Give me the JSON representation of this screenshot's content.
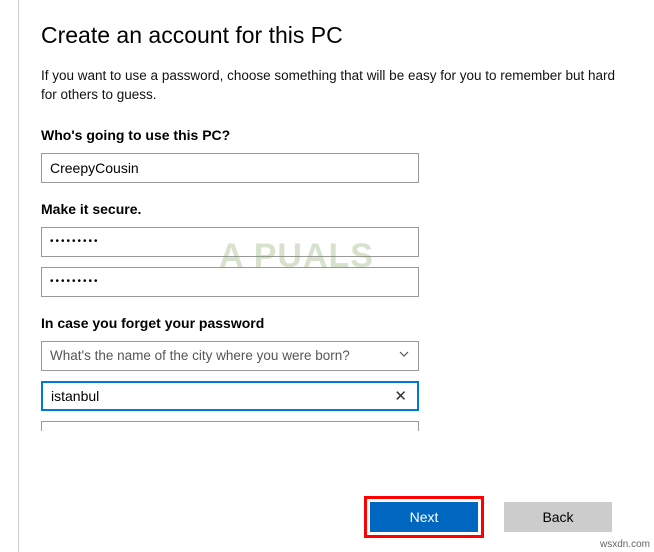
{
  "title": "Create an account for this PC",
  "description": "If you want to use a password, choose something that will be easy for you to remember but hard for others to guess.",
  "sections": {
    "user_label": "Who's going to use this PC?",
    "secure_label": "Make it secure.",
    "recovery_label": "In case you forget your password"
  },
  "fields": {
    "username": "CreepyCousin",
    "password1": "•••••••••",
    "password2": "•••••••••",
    "question_selected": "What's the name of the city where you were born?",
    "answer": "istanbul"
  },
  "buttons": {
    "next": "Next",
    "back": "Back"
  },
  "watermark": "A PUALS",
  "credit": "wsxdn.com"
}
